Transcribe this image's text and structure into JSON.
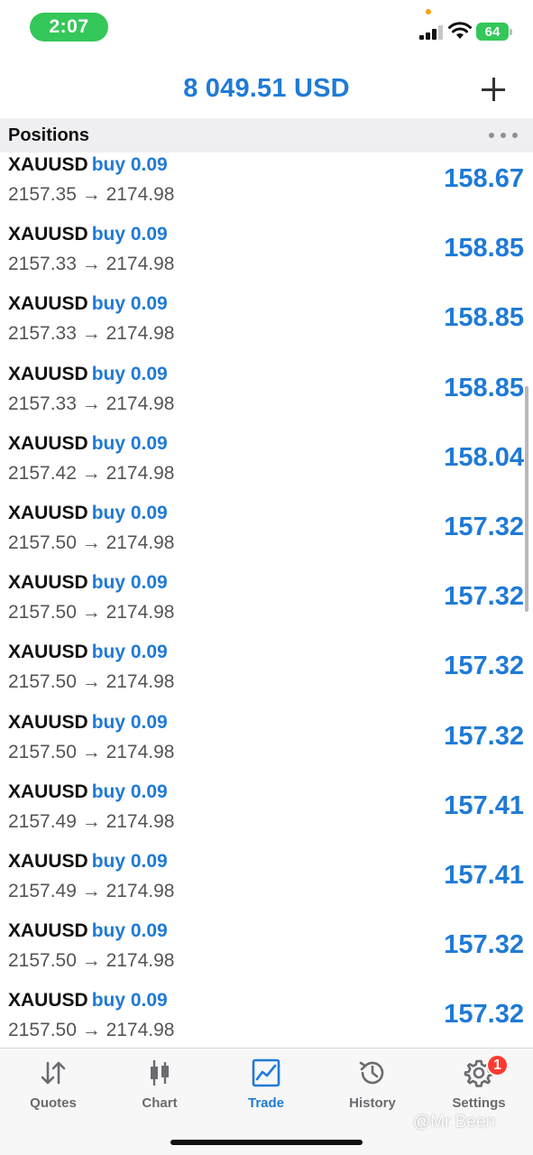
{
  "status_bar": {
    "time": "2:07",
    "battery": "64",
    "colors": {
      "time_pill": "#34c759",
      "battery": "#34c759"
    }
  },
  "header": {
    "balance": "8 049.51 USD",
    "add_icon": "plus-icon"
  },
  "section": {
    "title": "Positions",
    "more_icon": "more-horizontal-icon"
  },
  "positions": [
    {
      "symbol": "XAUUSD",
      "side": "buy 0.09",
      "prices": "2157.35 → 2174.98",
      "profit": "158.67"
    },
    {
      "symbol": "XAUUSD",
      "side": "buy 0.09",
      "prices": "2157.33 → 2174.98",
      "profit": "158.85"
    },
    {
      "symbol": "XAUUSD",
      "side": "buy 0.09",
      "prices": "2157.33 → 2174.98",
      "profit": "158.85"
    },
    {
      "symbol": "XAUUSD",
      "side": "buy 0.09",
      "prices": "2157.33 → 2174.98",
      "profit": "158.85"
    },
    {
      "symbol": "XAUUSD",
      "side": "buy 0.09",
      "prices": "2157.42 → 2174.98",
      "profit": "158.04"
    },
    {
      "symbol": "XAUUSD",
      "side": "buy 0.09",
      "prices": "2157.50 → 2174.98",
      "profit": "157.32"
    },
    {
      "symbol": "XAUUSD",
      "side": "buy 0.09",
      "prices": "2157.50 → 2174.98",
      "profit": "157.32"
    },
    {
      "symbol": "XAUUSD",
      "side": "buy 0.09",
      "prices": "2157.50 → 2174.98",
      "profit": "157.32"
    },
    {
      "symbol": "XAUUSD",
      "side": "buy 0.09",
      "prices": "2157.50 → 2174.98",
      "profit": "157.32"
    },
    {
      "symbol": "XAUUSD",
      "side": "buy 0.09",
      "prices": "2157.49 → 2174.98",
      "profit": "157.41"
    },
    {
      "symbol": "XAUUSD",
      "side": "buy 0.09",
      "prices": "2157.49 → 2174.98",
      "profit": "157.41"
    },
    {
      "symbol": "XAUUSD",
      "side": "buy 0.09",
      "prices": "2157.50 → 2174.98",
      "profit": "157.32"
    },
    {
      "symbol": "XAUUSD",
      "side": "buy 0.09",
      "prices": "2157.50 → 2174.98",
      "profit": "157.32"
    }
  ],
  "tab_bar": {
    "tabs": [
      {
        "label": "Quotes",
        "icon": "quotes-arrows-icon",
        "active": false
      },
      {
        "label": "Chart",
        "icon": "candlestick-icon",
        "active": false
      },
      {
        "label": "Trade",
        "icon": "trade-chart-icon",
        "active": true
      },
      {
        "label": "History",
        "icon": "history-clock-icon",
        "active": false
      },
      {
        "label": "Settings",
        "icon": "gear-icon",
        "active": false,
        "badge": "1"
      }
    ],
    "watermark": "@Mr Been"
  },
  "colors": {
    "accent": "#1f7ad6",
    "badge": "#ff3b30"
  }
}
